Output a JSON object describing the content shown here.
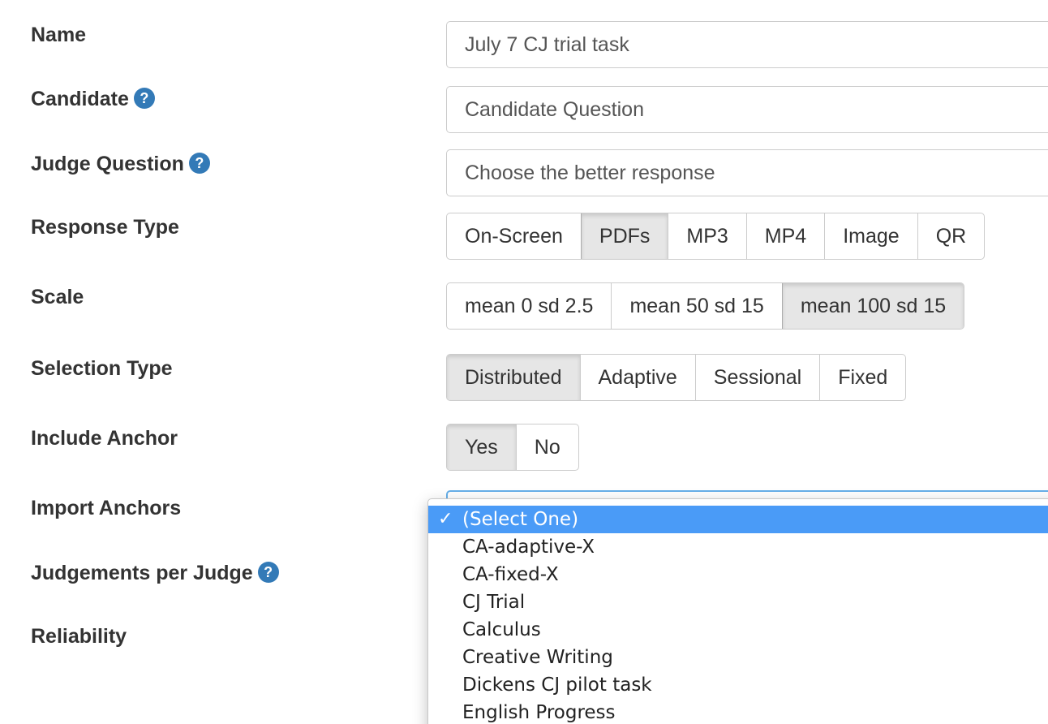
{
  "form": {
    "name": {
      "label": "Name",
      "value": "July 7 CJ trial task"
    },
    "candidate": {
      "label": "Candidate",
      "value": "Candidate Question",
      "help": "?"
    },
    "judge_question": {
      "label": "Judge Question",
      "value": "Choose the better response",
      "help": "?"
    },
    "response_type": {
      "label": "Response Type",
      "options": [
        "On-Screen",
        "PDFs",
        "MP3",
        "MP4",
        "Image",
        "QR"
      ],
      "selected": "PDFs"
    },
    "scale": {
      "label": "Scale",
      "options": [
        "mean 0 sd 2.5",
        "mean 50 sd 15",
        "mean 100 sd 15"
      ],
      "selected": "mean 100 sd 15"
    },
    "selection_type": {
      "label": "Selection Type",
      "options": [
        "Distributed",
        "Adaptive",
        "Sessional",
        "Fixed"
      ],
      "selected": "Distributed"
    },
    "include_anchor": {
      "label": "Include Anchor",
      "options": [
        "Yes",
        "No"
      ],
      "selected": "Yes"
    },
    "import_anchors": {
      "label": "Import Anchors",
      "dropdown_options": [
        "(Select One)",
        "CA-adaptive-X",
        "CA-fixed-X",
        "CJ Trial",
        "Calculus",
        "Creative Writing",
        "Dickens CJ pilot task",
        "English Progress"
      ],
      "selected": "(Select One)",
      "check_mark": "✓"
    },
    "judgements_per_judge": {
      "label": "Judgements per Judge",
      "help": "?"
    },
    "reliability": {
      "label": "Reliability"
    }
  },
  "colors": {
    "help_icon": "#337ab7",
    "selected_option": "#4a9bf7",
    "active_button": "#e6e6e6",
    "focus_border": "#66afe9"
  }
}
